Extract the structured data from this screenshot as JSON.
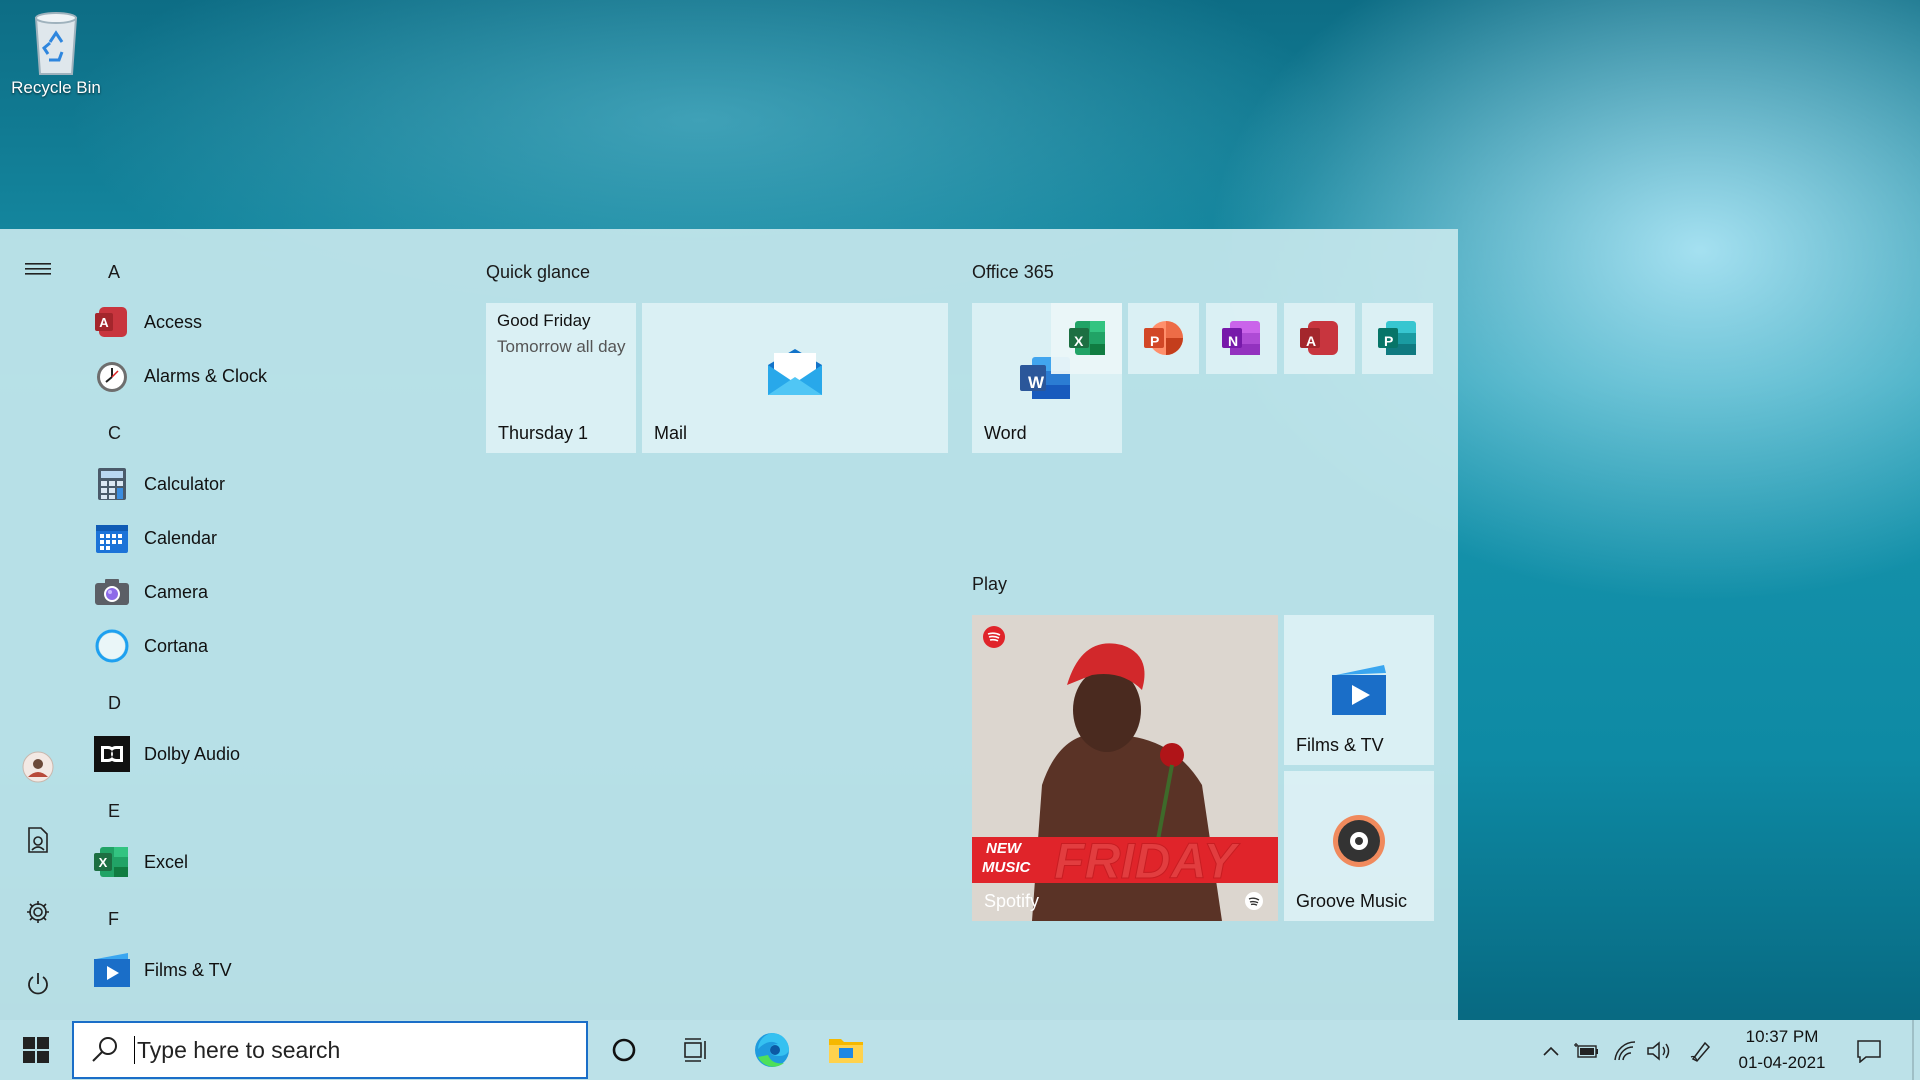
{
  "desktop": {
    "recycle_bin_label": "Recycle Bin"
  },
  "app_list": {
    "letters": {
      "a": "A",
      "c": "C",
      "d": "D",
      "e": "E",
      "f": "F"
    },
    "apps": {
      "access": "Access",
      "alarms": "Alarms & Clock",
      "calculator": "Calculator",
      "calendar": "Calendar",
      "camera": "Camera",
      "cortana": "Cortana",
      "dolby": "Dolby Audio",
      "excel": "Excel",
      "films": "Films & TV"
    }
  },
  "groups": {
    "quick_glance": "Quick glance",
    "office": "Office 365",
    "play": "Play"
  },
  "tiles": {
    "calendar_event": "Good Friday",
    "calendar_detail": "Tomorrow all day",
    "calendar_day": "Thursday 1",
    "mail": "Mail",
    "word": "Word",
    "spotify": "Spotify",
    "spotify_banner_top": "NEW",
    "spotify_banner_bottom": "MUSIC",
    "spotify_banner_big": "FRIDAY",
    "films_tv": "Films & TV",
    "groove": "Groove Music"
  },
  "office_letters": {
    "excel": "X",
    "powerpoint": "P",
    "onenote": "N",
    "access": "A",
    "publisher": "P",
    "word": "W"
  },
  "taskbar": {
    "search_placeholder": "Type here to search",
    "time": "10:37 PM",
    "date": "01-04-2021"
  },
  "colors": {
    "accent": "#1a6ec8",
    "access": "#a4262c",
    "excel": "#1d6f42",
    "word": "#2b579a",
    "powerpoint": "#d24726",
    "onenote": "#7719aa",
    "publisher": "#077568",
    "spotify_green": "#1db954",
    "friday_red": "#e0242a"
  }
}
